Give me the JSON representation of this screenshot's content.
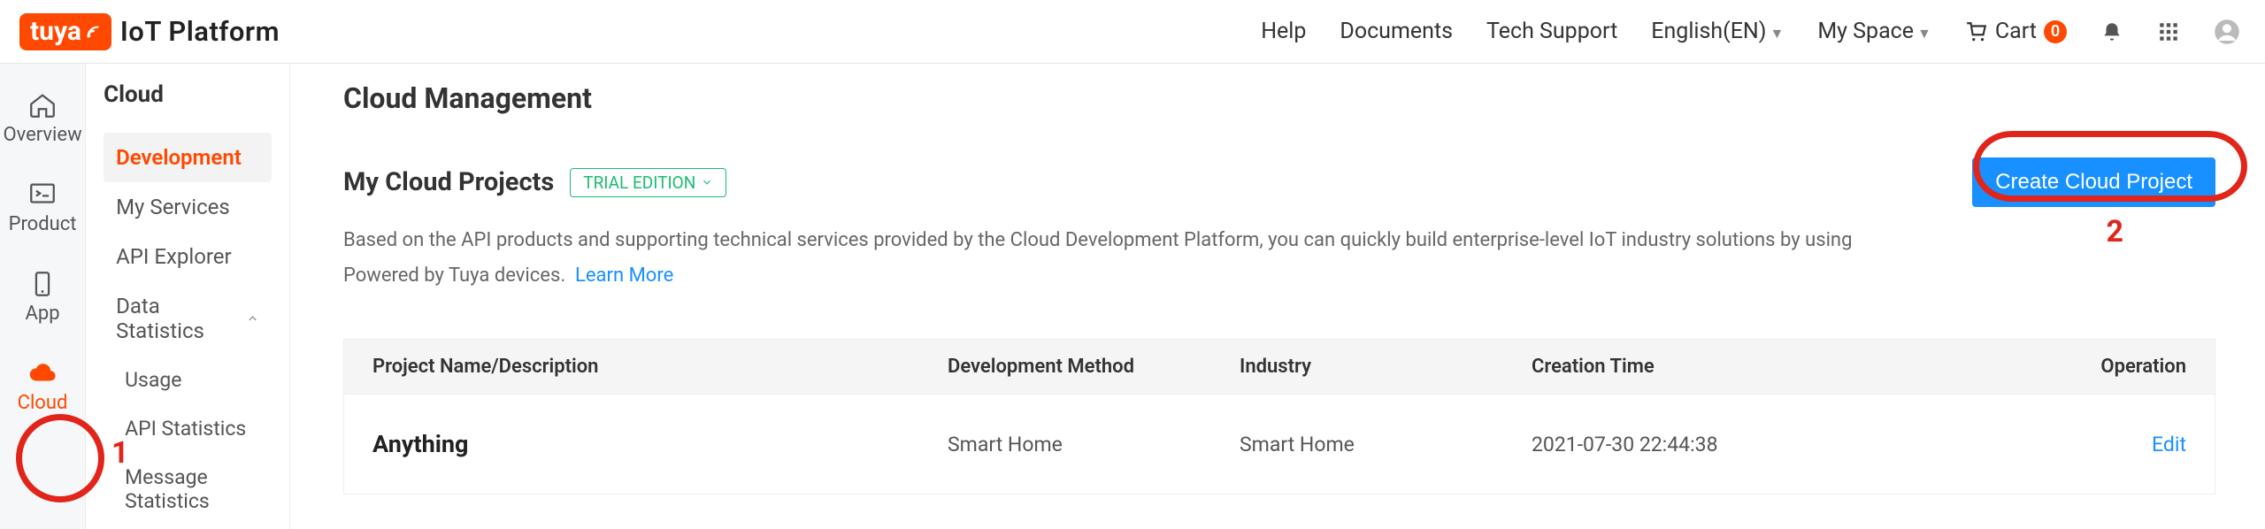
{
  "brand": {
    "logo_text": "tuya",
    "platform_text": "IoT Platform"
  },
  "topnav": {
    "help": "Help",
    "documents": "Documents",
    "tech_support": "Tech Support",
    "language": "English(EN)",
    "my_space": "My Space",
    "cart_label": "Cart",
    "cart_count": "0"
  },
  "rail": {
    "overview": "Overview",
    "product": "Product",
    "app": "App",
    "cloud": "Cloud"
  },
  "subnav": {
    "title": "Cloud",
    "development": "Development",
    "my_services": "My Services",
    "api_explorer": "API Explorer",
    "data_statistics": "Data Statistics",
    "usage": "Usage",
    "api_statistics": "API Statistics",
    "message_statistics": "Message Statistics"
  },
  "main": {
    "page_title": "Cloud Management",
    "section_title": "My Cloud Projects",
    "edition_label": "TRIAL EDITION",
    "create_button": "Create Cloud Project",
    "description": "Based on the API products and supporting technical services provided by the Cloud Development Platform, you can quickly build enterprise-level IoT industry solutions by using Powered by Tuya devices.",
    "learn_more": "Learn More"
  },
  "annotations": {
    "one": "1",
    "two": "2"
  },
  "table": {
    "columns": {
      "project": "Project Name/Description",
      "method": "Development Method",
      "industry": "Industry",
      "creation_time": "Creation Time",
      "operation": "Operation"
    },
    "rows": [
      {
        "name": "Anything",
        "method": "Smart Home",
        "industry": "Smart Home",
        "creation_time": "2021-07-30 22:44:38",
        "operation": "Edit"
      }
    ]
  }
}
